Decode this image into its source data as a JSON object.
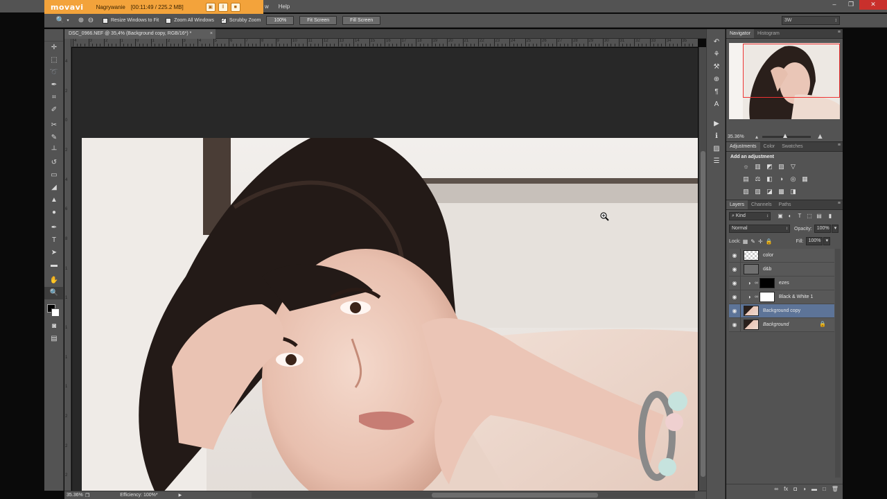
{
  "menubar": {
    "items": [
      "Help"
    ]
  },
  "recorder": {
    "brand": "movavi",
    "label": "Nagrywanie",
    "status": "[00:11:49 / 225.2 MB]"
  },
  "options_bar": {
    "resize_windows": "Resize Windows to Fit",
    "zoom_all": "Zoom All Windows",
    "scrubby": "Scrubby Zoom",
    "btn_100": "100%",
    "btn_fit": "Fit Screen",
    "btn_fill": "Fill Screen",
    "workspace": "3W"
  },
  "document": {
    "tab_title": "DSC_0966.NEF @ 35,4% (Background copy, RGB/16*) *"
  },
  "ruler": {
    "top": [
      "4",
      "3",
      "2",
      "1",
      "0",
      "1",
      "2",
      "3",
      "4",
      "5",
      "6",
      "7",
      "8",
      "9",
      "10",
      "11",
      "12",
      "13",
      "14",
      "15",
      "16",
      "17",
      "18",
      "19",
      "20",
      "21",
      "22",
      "23",
      "24",
      "25",
      "26",
      "27",
      "28",
      "29",
      "30",
      "31",
      "32",
      "33",
      "34",
      "35"
    ],
    "left": [
      "4",
      "2",
      "0",
      "2",
      "4",
      "6",
      "8",
      "1",
      "1",
      "1",
      "1",
      "1",
      "2",
      "2",
      "2"
    ]
  },
  "status_bar": {
    "zoom": "35.36%",
    "efficiency": "Efficiency: 100%*"
  },
  "navigator": {
    "tabs": [
      "Navigator",
      "Histogram"
    ],
    "zoom": "35.36%"
  },
  "adjustments": {
    "tabs": [
      "Adjustments",
      "Color",
      "Swatches"
    ],
    "title": "Add an adjustment",
    "row1": [
      "☼",
      "▥",
      "◩",
      "▨",
      "▽"
    ],
    "row2": [
      "▤",
      "⚖",
      "◧",
      "◑",
      "◎",
      "▦"
    ],
    "row3": [
      "▧",
      "▨",
      "◪",
      "▩",
      "◨"
    ]
  },
  "layers": {
    "tabs": [
      "Layers",
      "Channels",
      "Paths"
    ],
    "kind": "Kind",
    "blend_mode": "Normal",
    "opacity_label": "Opacity:",
    "opacity": "100%",
    "lock_label": "Lock:",
    "fill_label": "Fill:",
    "fill": "100%",
    "items": [
      {
        "name": "color"
      },
      {
        "name": "d&b"
      },
      {
        "name": "ezes"
      },
      {
        "name": "Black & White 1"
      },
      {
        "name": "Background copy"
      },
      {
        "name": "Background"
      }
    ]
  },
  "colors": {
    "accent_recorder": "#f3a33b",
    "selected_layer": "#5d7498",
    "panel_bg": "#535353"
  }
}
